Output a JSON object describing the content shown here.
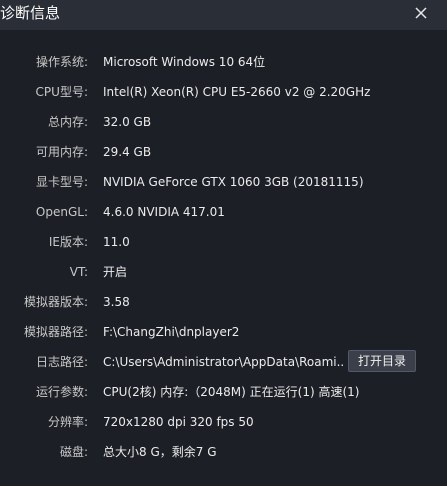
{
  "window": {
    "title": "诊断信息"
  },
  "rows": [
    {
      "label": "操作系统:",
      "value": "Microsoft Windows 10 64位"
    },
    {
      "label": "CPU型号:",
      "value": "Intel(R) Xeon(R) CPU E5-2660 v2 @ 2.20GHz"
    },
    {
      "label": "总内存:",
      "value": "32.0 GB"
    },
    {
      "label": "可用内存:",
      "value": "29.4 GB"
    },
    {
      "label": "显卡型号:",
      "value": "NVIDIA GeForce GTX 1060 3GB (20181115)"
    },
    {
      "label": "OpenGL:",
      "value": "4.6.0 NVIDIA 417.01"
    },
    {
      "label": "IE版本:",
      "value": "11.0"
    },
    {
      "label": "VT:",
      "value": "开启"
    },
    {
      "label": "模拟器版本:",
      "value": "3.58"
    },
    {
      "label": "模拟器路径:",
      "value": "F:\\ChangZhi\\dnplayer2"
    },
    {
      "label": "日志路径:",
      "value": "C:\\Users\\Administrator\\AppData\\Roami..."
    },
    {
      "label": "运行参数:",
      "value": "CPU(2核) 内存:（2048M) 正在运行(1) 高速(1)"
    },
    {
      "label": "分辨率:",
      "value": "720x1280 dpi 320 fps 50"
    },
    {
      "label": "磁盘:",
      "value": "总大小8 G，剩余7 G"
    }
  ],
  "buttons": {
    "open_dir": "打开目录"
  }
}
